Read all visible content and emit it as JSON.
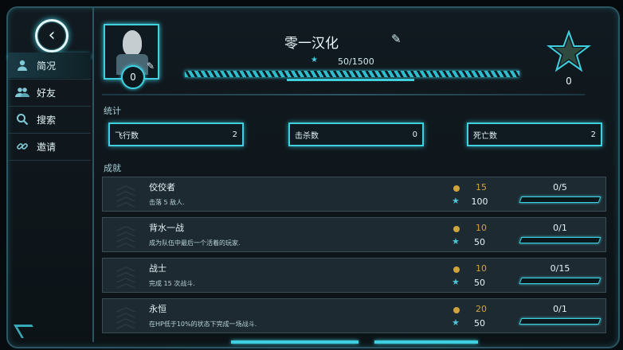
{
  "profile": {
    "name": "零一汉化",
    "level": "0",
    "xp_text": "50/1500",
    "xp_fraction": 0.033,
    "rank": "0"
  },
  "sidebar": {
    "items": [
      {
        "label": "简况",
        "icon": "person-icon"
      },
      {
        "label": "好友",
        "icon": "friends-icon"
      },
      {
        "label": "搜索",
        "icon": "search-icon"
      },
      {
        "label": "邀请",
        "icon": "link-icon"
      }
    ]
  },
  "stats": {
    "title": "统计",
    "items": [
      {
        "label": "飞行数",
        "value": "2"
      },
      {
        "label": "击杀数",
        "value": "0"
      },
      {
        "label": "死亡数",
        "value": "2"
      }
    ]
  },
  "achievements": {
    "title": "成就",
    "items": [
      {
        "name": "佼佼者",
        "desc": "击落 5 敌人.",
        "coins": "15",
        "stars": "100",
        "progress": "0/5",
        "fraction": 0
      },
      {
        "name": "背水一战",
        "desc": "成为队伍中最后一个活着的玩家.",
        "coins": "10",
        "stars": "50",
        "progress": "0/1",
        "fraction": 0
      },
      {
        "name": "战士",
        "desc": "完成 15 次战斗.",
        "coins": "10",
        "stars": "50",
        "progress": "0/15",
        "fraction": 0
      },
      {
        "name": "永恒",
        "desc": "在HP低于10%的状态下完成一场战斗.",
        "coins": "20",
        "stars": "50",
        "progress": "0/1",
        "fraction": 0
      }
    ]
  },
  "colors": {
    "accent": "#3fd0e0",
    "coin": "#d1a33c",
    "panel": "#1e2a31"
  }
}
